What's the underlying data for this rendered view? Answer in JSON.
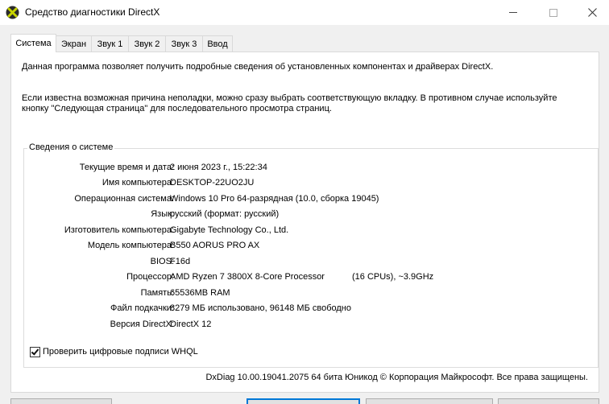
{
  "window": {
    "title": "Средство диагностики DirectX",
    "icon": "directx-icon",
    "controls": [
      "minimize-icon",
      "maximize-icon",
      "close-icon"
    ]
  },
  "tabs": [
    {
      "label": "Система",
      "active": true
    },
    {
      "label": "Экран",
      "active": false
    },
    {
      "label": "Звук 1",
      "active": false
    },
    {
      "label": "Звук 2",
      "active": false
    },
    {
      "label": "Звук 3",
      "active": false
    },
    {
      "label": "Ввод",
      "active": false
    }
  ],
  "intro": {
    "line1": "Данная программа позволяет получить подробные сведения об установленных компонентах и драйверах DirectX.",
    "line2": "Если известна возможная причина неполадки, можно сразу выбрать соответствующую вкладку. В противном случае используйте кнопку \"Следующая страница\" для последовательного просмотра страниц."
  },
  "system_info": {
    "group_title": "Сведения о системе",
    "rows": [
      {
        "label": "Текущие время и дата:",
        "value": "2 июня 2023 г., 15:22:34"
      },
      {
        "label": "Имя компьютера:",
        "value": "DESKTOP-22UO2JU"
      },
      {
        "label": "Операционная система:",
        "value": "Windows 10 Pro 64-разрядная (10.0, сборка 19045)"
      },
      {
        "label": "Язык:",
        "value": "русский (формат: русский)"
      },
      {
        "label": "Изготовитель компьютера:",
        "value": "Gigabyte Technology Co., Ltd."
      },
      {
        "label": "Модель компьютера:",
        "value": "B550 AORUS PRO AX"
      },
      {
        "label": "BIOS:",
        "value": "F16d"
      },
      {
        "label": "Процессор:",
        "value": "AMD Ryzen 7 3800X 8-Core Processor",
        "extra": "(16 CPUs), ~3.9GHz"
      },
      {
        "label": "Память:",
        "value": "65536MB RAM"
      },
      {
        "label": "Файл подкачки:",
        "value": "8279 МБ использовано, 96148 МБ свободно"
      },
      {
        "label": "Версия DirectX:",
        "value": "DirectX 12"
      }
    ]
  },
  "whql": {
    "label": "Проверить цифровые подписи WHQL",
    "checked": true
  },
  "footer": {
    "text": "DxDiag 10.00.19041.2075 64 бита Юникод  © Корпорация Майкрософт. Все права защищены."
  }
}
